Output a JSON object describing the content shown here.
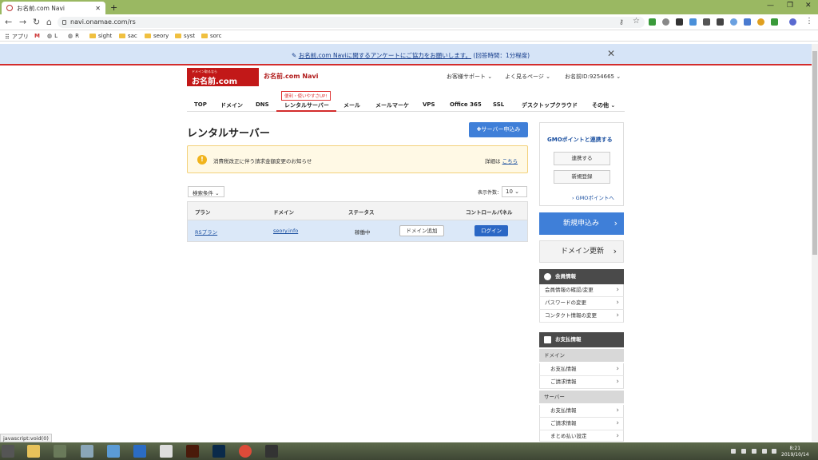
{
  "browser": {
    "tab_title": "お名前.com Navi",
    "url": "navi.onamae.com/rs",
    "bookmarks": [
      "アプリ",
      "L",
      "R",
      "sight",
      "sac",
      "seory",
      "syst",
      "sorc"
    ]
  },
  "banner": {
    "link_text": "お名前.com Naviに関するアンケートにご協力をお願いします。",
    "note": "(回答時間：1分程度)"
  },
  "header": {
    "logo_text": "お名前.com",
    "logo_small": "ドメイン取るなら",
    "site_title": "お名前.com Navi",
    "support": "お客様サポート ⌄",
    "pages": "よく見るページ ⌄",
    "member_id": "お名前ID:9254665 ⌄"
  },
  "nav": {
    "badge": "便利・使いやすさUP!",
    "items": [
      "TOP",
      "ドメイン",
      "DNS",
      "レンタルサーバー",
      "メール",
      "メールマーケ",
      "VPS",
      "Office 365",
      "SSL",
      "デスクトップクラウド",
      "その他 ⌄"
    ]
  },
  "main": {
    "title": "レンタルサーバー",
    "server_button": "✚サーバー申込み",
    "notice_text": "消費税改正に伴う請求金額変更のお知らせ",
    "notice_detail_label": "詳細は",
    "notice_detail_link": "こちら",
    "search_condition": "検索条件 ⌄",
    "per_page_label": "表示件数：",
    "per_page_value": "10 ⌄",
    "table": {
      "headers": [
        "プラン",
        "ドメイン",
        "ステータス",
        "コントロールパネル"
      ],
      "row": {
        "plan": "RSプラン",
        "domain": "seory.info",
        "status": "稼働中",
        "add_domain": "ドメイン追加",
        "login": "ログイン"
      }
    }
  },
  "sidebar": {
    "gmo_title": "GMOポイントと連携する",
    "gmo_link_btn": "連携する",
    "gmo_register_btn": "新規登録",
    "gmo_points_link": "› GMOポイントへ",
    "new_order": "新規申込み",
    "renew_domain": "ドメイン更新",
    "member_head": "会員情報",
    "member_items": [
      "会員情報の確認/変更",
      "パスワードの変更",
      "コンタクト情報の変更"
    ],
    "payment_head": "お支払情報",
    "cat_domain": "ドメイン",
    "domain_items": [
      "お支払情報",
      "ご請求情報"
    ],
    "cat_server": "サーバー",
    "server_items": [
      "お支払情報",
      "ご請求情報",
      "まとめ払い設定"
    ]
  },
  "status_bar": "javascript:void(0)",
  "clock": {
    "time": "8:21",
    "date": "2019/10/14"
  },
  "colors": {
    "brand_red": "#c21818",
    "primary_blue": "#3f7fd8",
    "banner_bg": "#d6e4f7"
  }
}
